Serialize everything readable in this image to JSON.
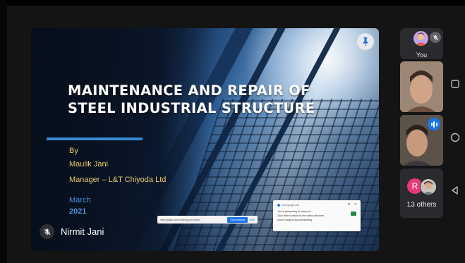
{
  "presentation": {
    "title_line1": "MAINTENANCE AND REPAIR OF",
    "title_line2": "STEEL INDUSTRIAL STRUCTURE",
    "by_label": "By",
    "author": "Maulik Jani",
    "role": "Manager – L&T Chiyoda  Ltd",
    "month": "March",
    "year": "2021"
  },
  "share_bar": {
    "message": "meet.google.com is sharing your screen.",
    "stop_label": "Stop sharing",
    "hide_label": "Hide"
  },
  "popup": {
    "source": "meet.google.com",
    "line1": "You're presenting to everyone",
    "line2": "Click here to return to the video call when",
    "line3": "you're ready to stop presenting"
  },
  "presenter": {
    "name": "Nirmit Jani"
  },
  "participants": {
    "you_label": "You",
    "others_initial": "R",
    "others_count_label": "13 others"
  },
  "colors": {
    "accent_blue": "#3b8ad6",
    "author_gold": "#e8c86a",
    "speaking_blue": "#1a73e8",
    "avatar_pink": "#e6397a"
  }
}
